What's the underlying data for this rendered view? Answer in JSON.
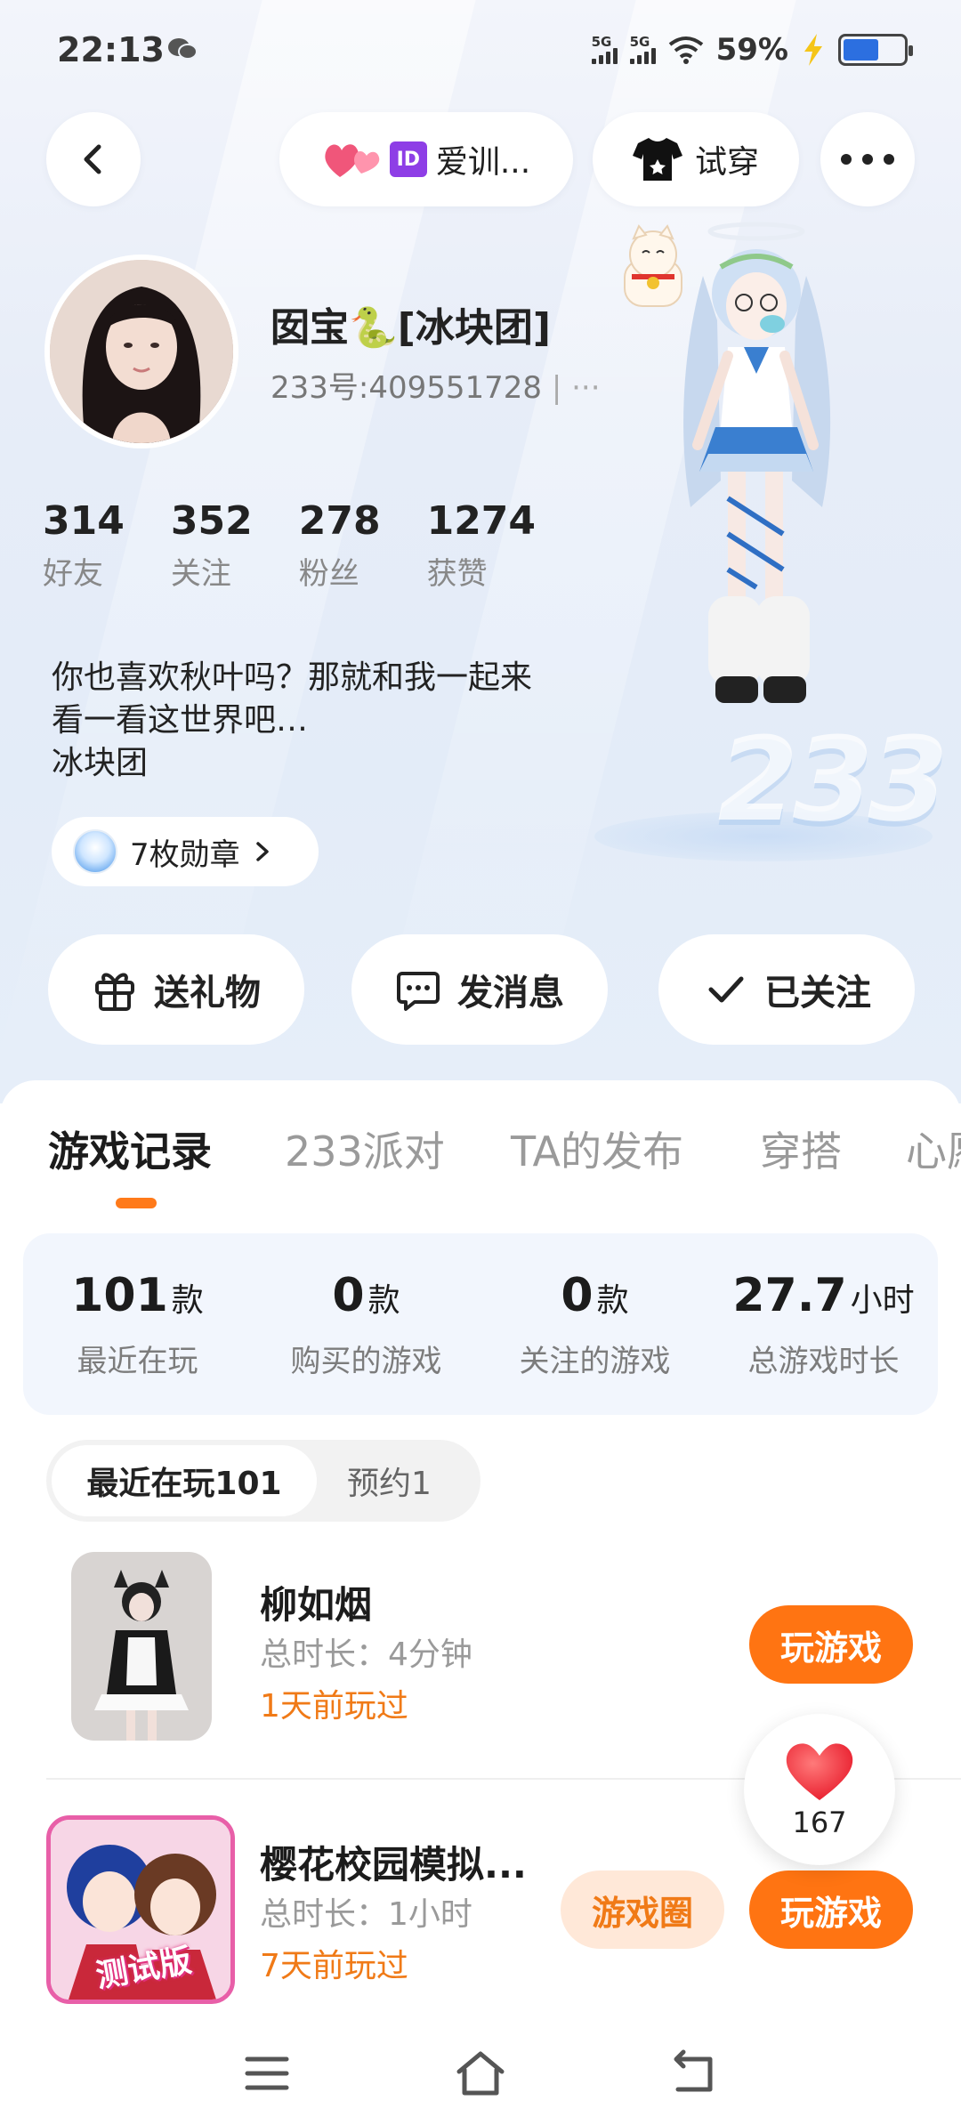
{
  "status_bar": {
    "time": "22:13",
    "network_1": "5G",
    "network_2": "5G",
    "battery_percent": "59%",
    "battery_level": 0.59
  },
  "top_nav": {
    "club_label": "爱训...",
    "id_badge": "ID",
    "tryon_label": "试穿"
  },
  "profile": {
    "nickname": "囡宝🐍[冰块团]",
    "uid": "233号:409551728",
    "uid_more": "| ···",
    "stats": [
      {
        "value": "314",
        "label": "好友"
      },
      {
        "value": "352",
        "label": "关注"
      },
      {
        "value": "278",
        "label": "粉丝"
      },
      {
        "value": "1274",
        "label": "获赞"
      }
    ],
    "bio": "你也喜欢秋叶吗？那就和我一起来\n看一看这世界吧…\n冰块团",
    "medals_label": "7枚勋章"
  },
  "decor": {
    "brand_number": "233"
  },
  "actions": {
    "gift": "送礼物",
    "message": "发消息",
    "following": "已关注"
  },
  "tabs": [
    "游戏记录",
    "233派对",
    "TA的发布",
    "穿搭",
    "心愿"
  ],
  "summary": [
    {
      "value": "101",
      "unit": "款",
      "caption": "最近在玩"
    },
    {
      "value": "0",
      "unit": "款",
      "caption": "购买的游戏"
    },
    {
      "value": "0",
      "unit": "款",
      "caption": "关注的游戏"
    },
    {
      "value": "27.7",
      "unit": "小时",
      "caption": "总游戏时长"
    }
  ],
  "segments": {
    "recent": "最近在玩101",
    "reserved": "预约1"
  },
  "games": [
    {
      "title": "柳如烟",
      "duration": "总时长：4分钟",
      "last_played": "1天前玩过",
      "play_label": "玩游戏"
    },
    {
      "title": "樱花校园模拟...",
      "duration": "总时长：1小时",
      "last_played": "7天前玩过",
      "circle_label": "游戏圈",
      "play_label": "玩游戏",
      "icon_badge": "测试版"
    }
  ],
  "like_float": {
    "count": "167"
  },
  "colors": {
    "accent": "#ff7412",
    "accent_soft": "#ffe8d8",
    "hero_bg": "#e7edf8",
    "summary_bg": "#f2f6fd",
    "id_badge": "#8e3ee6"
  }
}
